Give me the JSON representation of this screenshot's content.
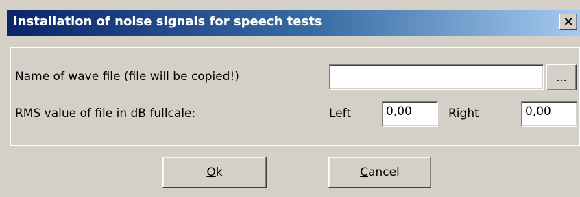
{
  "dialog": {
    "title": "Installation of noise signals for speech tests",
    "close_glyph": "×"
  },
  "form": {
    "wave_file_label": "Name of wave file (file will be copied!)",
    "wave_file_value": "",
    "browse_label": "...",
    "rms_label": "RMS value of file in dB fullcale:",
    "left_label": "Left",
    "left_value": "0,00",
    "right_label": "Right",
    "right_value": "0,00"
  },
  "buttons": {
    "ok_mnemonic": "O",
    "ok_rest": "k",
    "cancel_mnemonic": "C",
    "cancel_rest": "ancel"
  },
  "colors": {
    "dialog_bg": "#d4d0c8",
    "title_start": "#0a246a",
    "title_end": "#a6caf0",
    "title_text": "#ffffff"
  }
}
